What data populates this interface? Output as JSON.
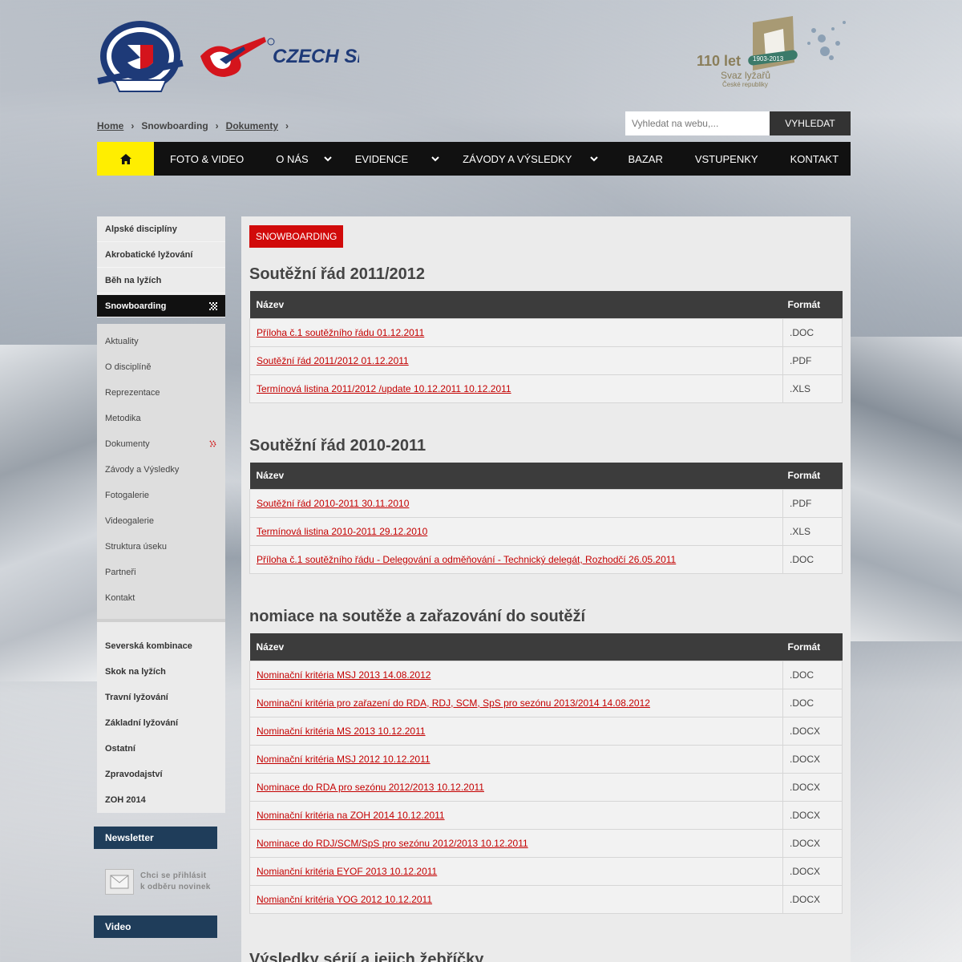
{
  "header": {
    "logo_svaz_alt": "Svaz lyžařů České republiky 1903",
    "logo_czechski_text": "CZECH SKI",
    "logo_110_line1": "110 let",
    "logo_110_badge": "1903-2013",
    "logo_110_line2": "Svaz lyžařů",
    "logo_110_line3": "České republiky"
  },
  "breadcrumb": {
    "items": [
      {
        "label": "Home",
        "link": true
      },
      {
        "label": "Snowboarding",
        "link": false
      },
      {
        "label": "Dokumenty",
        "link": true
      }
    ]
  },
  "search": {
    "placeholder": "Vyhledat na webu,...",
    "button": "Vyhledat"
  },
  "nav": {
    "items": [
      {
        "label": "Foto & Video",
        "dropdown": false
      },
      {
        "label": "O nás",
        "dropdown": true
      },
      {
        "label": "Evidence",
        "dropdown": true
      },
      {
        "label": "Závody a výsledky",
        "dropdown": true
      },
      {
        "label": "Bazar",
        "dropdown": false
      },
      {
        "label": "Vstupenky",
        "dropdown": false
      },
      {
        "label": "Kontakt",
        "dropdown": false
      }
    ]
  },
  "sidebar": {
    "main": [
      "Alpské disciplíny",
      "Akrobatické lyžování",
      "Běh na lyžích"
    ],
    "active": "Snowboarding",
    "sub": [
      "Aktuality",
      "O disciplíně",
      "Reprezentace",
      "Metodika",
      "Dokumenty",
      "Závody a Výsledky",
      "Fotogalerie",
      "Videogalerie",
      "Struktura úseku",
      "Partneři",
      "Kontakt"
    ],
    "main2": [
      "Severská kombinace",
      "Skok na lyžích",
      "Travní lyžování",
      "Základní lyžování",
      "Ostatní",
      "Zpravodajství",
      "ZOH 2014"
    ],
    "newsletter_title": "Newsletter",
    "newsletter_line1": "Chci se přihlásit",
    "newsletter_line2": "k odběru novinek",
    "video_title": "Video"
  },
  "main": {
    "badge": "Snowboarding",
    "col_name": "Název",
    "col_format": "Formát",
    "sections": [
      {
        "title": "Soutěžní řád 2011/2012",
        "rows": [
          {
            "name": "Příloha č.1 soutěžního řádu 01.12.2011",
            "format": ".DOC"
          },
          {
            "name": "Soutěžní řád 2011/2012 01.12.2011",
            "format": ".PDF"
          },
          {
            "name": "Termínová listina 2011/2012 /update 10.12.2011 10.12.2011",
            "format": ".XLS"
          }
        ]
      },
      {
        "title": "Soutěžní řád 2010-2011",
        "rows": [
          {
            "name": "Soutěžní řád 2010-2011 30.11.2010",
            "format": ".PDF"
          },
          {
            "name": "Termínová listina 2010-2011 29.12.2010",
            "format": ".XLS"
          },
          {
            "name": "Příloha č.1 soutěžního řádu - Delegování a odměňování - Technický delegát, Rozhodčí 26.05.2011",
            "format": ".DOC"
          }
        ]
      },
      {
        "title": "nomiace na soutěže a zařazování do soutěží",
        "rows": [
          {
            "name": "Nominační kritéria MSJ 2013 14.08.2012",
            "format": ".DOC"
          },
          {
            "name": "Nominační kritéria pro zařazení do RDA, RDJ, SCM, SpS pro sezónu 2013/2014 14.08.2012",
            "format": ".DOC"
          },
          {
            "name": "Nominační kritéria MS 2013 10.12.2011",
            "format": ".DOCX"
          },
          {
            "name": "Nominační kritéria MSJ 2012 10.12.2011",
            "format": ".DOCX"
          },
          {
            "name": "Nominace do RDA pro sezónu 2012/2013 10.12.2011",
            "format": ".DOCX"
          },
          {
            "name": "Nominační kritéria na ZOH 2014 10.12.2011",
            "format": ".DOCX"
          },
          {
            "name": "Nominace do RDJ/SCM/SpS pro sezónu 2012/2013 10.12.2011",
            "format": ".DOCX"
          },
          {
            "name": "Nomianční kritéria EYOF 2013 10.12.2011",
            "format": ".DOCX"
          },
          {
            "name": "Nomianční kritéria YOG 2012 10.12.2011",
            "format": ".DOCX"
          }
        ]
      },
      {
        "title": "Výsledky sérií a jejich žebříčky",
        "rows": []
      }
    ]
  },
  "colors": {
    "accent_red": "#d10a0a",
    "link_red": "#c40000",
    "home_yellow": "#ffee00",
    "nav_black": "#111111",
    "sidebar_blue": "#1f3d5a"
  }
}
